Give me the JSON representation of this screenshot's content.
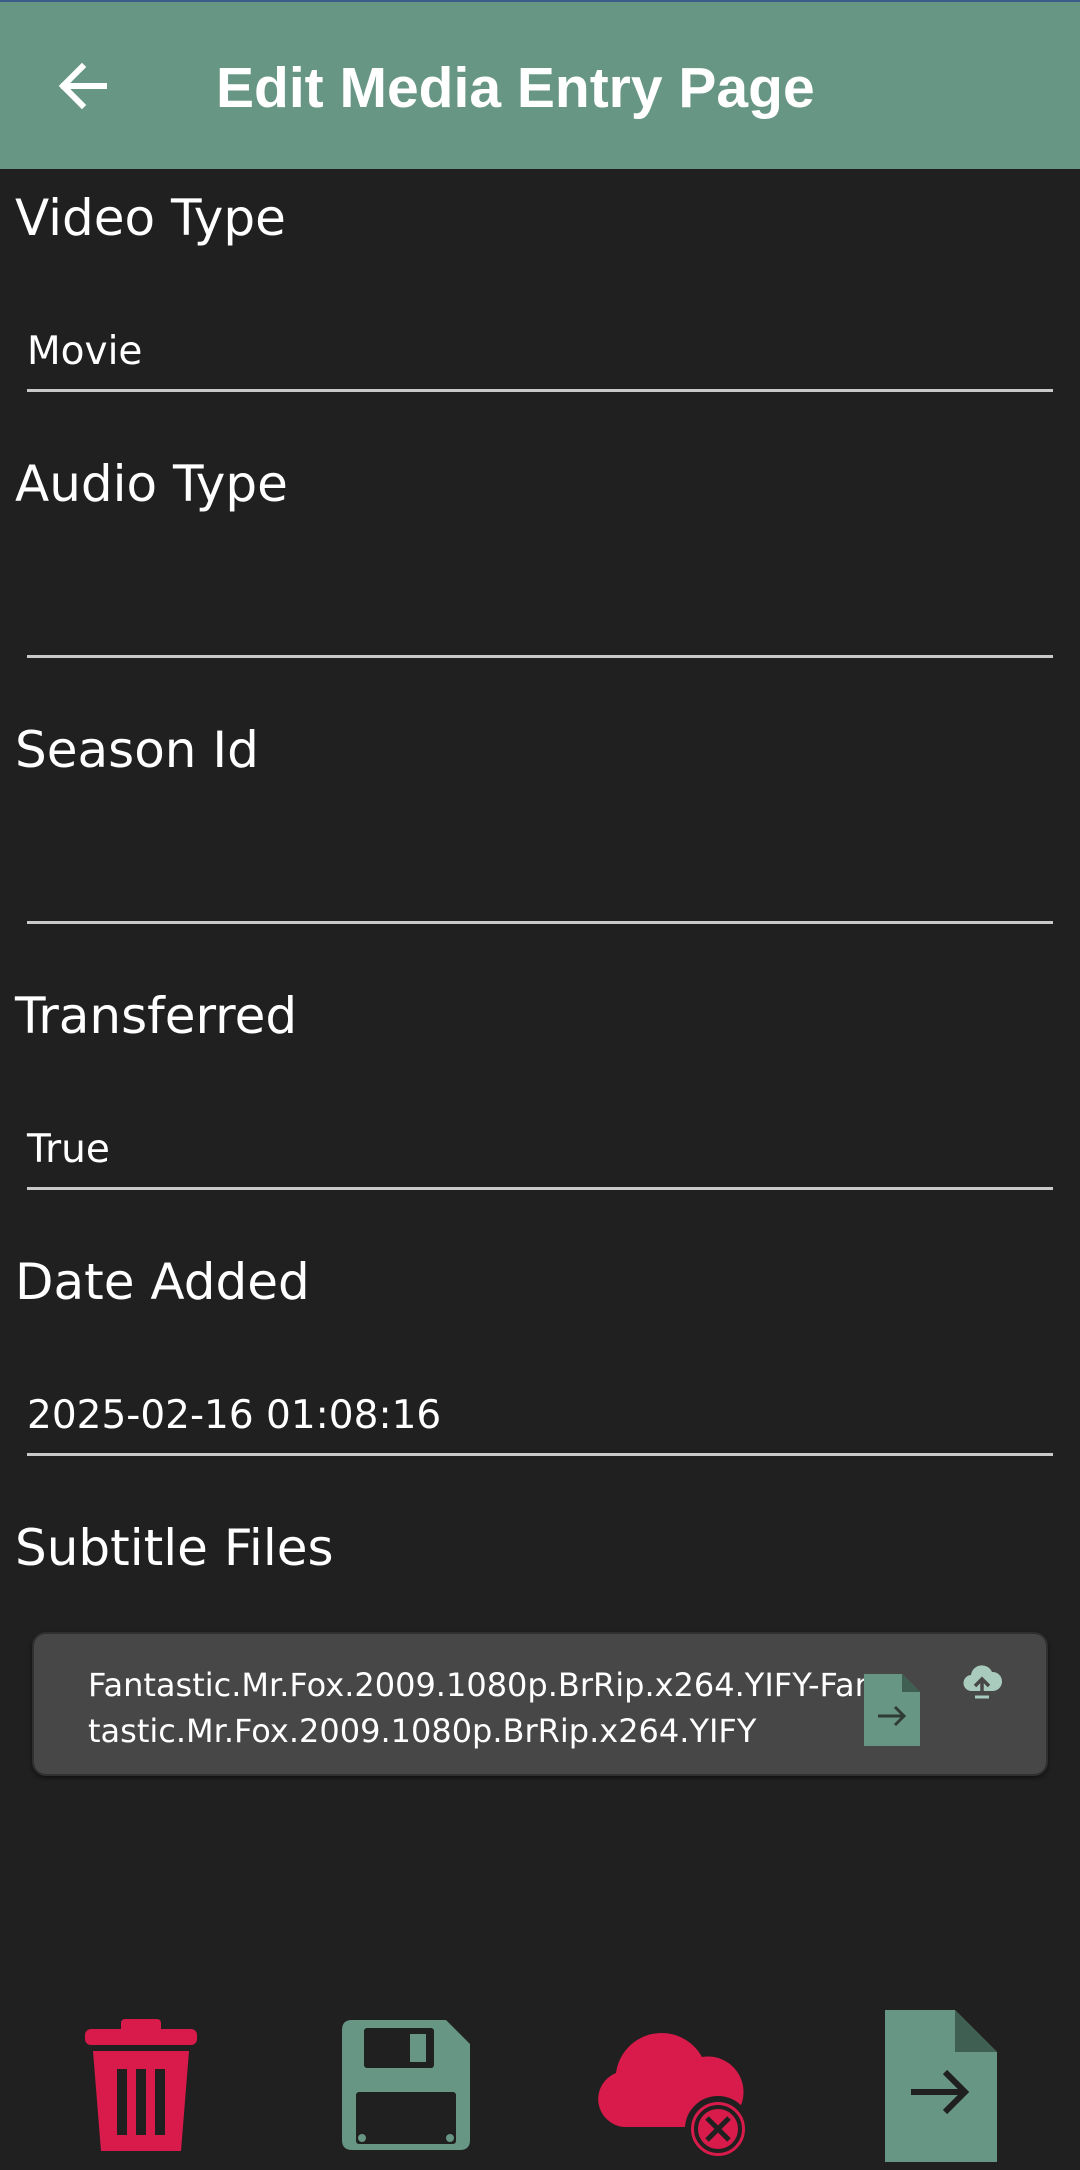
{
  "appbar": {
    "title": "Edit Media Entry Page",
    "back_icon": "arrow-left-icon",
    "background_color": "#679684"
  },
  "fields": {
    "video_type": {
      "label": "Video Type",
      "value": "Movie"
    },
    "audio_type": {
      "label": "Audio Type",
      "value": ""
    },
    "season_id": {
      "label": "Season Id",
      "value": ""
    },
    "transferred": {
      "label": "Transferred",
      "value": "True"
    },
    "date_added": {
      "label": "Date Added",
      "value": "2025-02-16 01:08:16"
    }
  },
  "subtitles": {
    "label": "Subtitle Files",
    "files": [
      {
        "name": "Fantastic.Mr.Fox.2009.1080p.BrRip.x264.YIFY-Fantastic.Mr.Fox.2009.1080p.BrRip.x264.YIFY",
        "open_icon": "file-arrow-icon",
        "upload_icon": "cloud-upload-icon"
      }
    ]
  },
  "bottom_bar": {
    "delete_icon": "trash-icon",
    "save_icon": "floppy-disk-icon",
    "cloud_remove_icon": "cloud-remove-icon",
    "open_file_icon": "file-arrow-icon"
  },
  "colors": {
    "accent_green": "#679684",
    "danger_red": "#d81b4b",
    "background": "#202020"
  }
}
